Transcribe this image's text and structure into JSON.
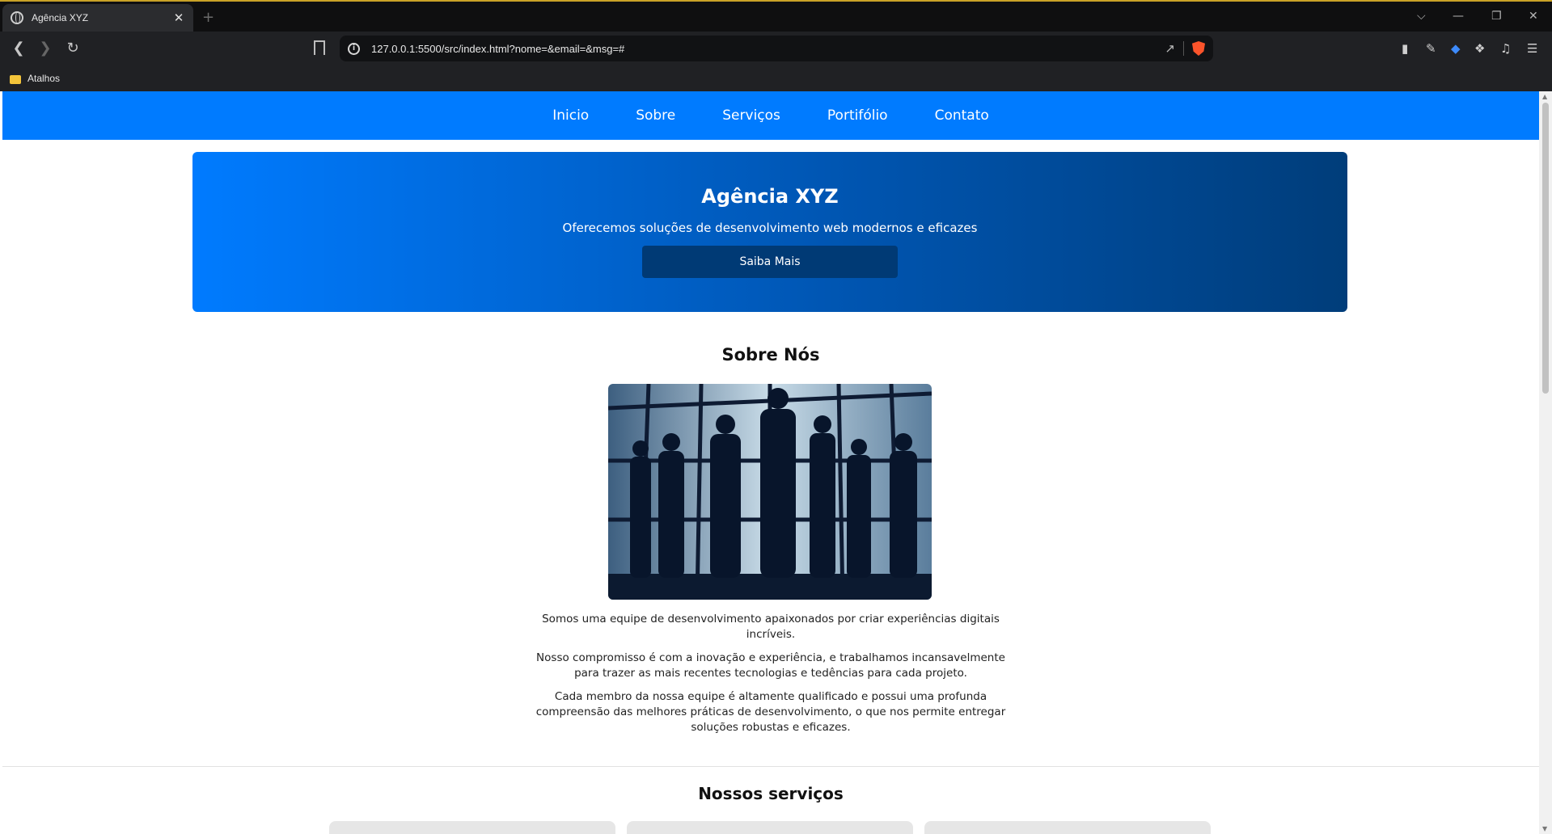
{
  "browser": {
    "tab_title": "Agência XYZ",
    "tab_close": "✕",
    "new_tab": "+",
    "url": "127.0.0.1:5500/src/index.html?nome=&email=&msg=#",
    "bookmark_folder": "Atalhos",
    "window_controls": [
      "⌵",
      "—",
      "❐",
      "✕"
    ]
  },
  "nav": {
    "items": [
      "Inicio",
      "Sobre",
      "Serviços",
      "Portifólio",
      "Contato"
    ]
  },
  "hero": {
    "title": "Agência XYZ",
    "subtitle": "Oferecemos soluções de desenvolvimento web modernos e eficazes",
    "button": "Saiba Mais"
  },
  "about": {
    "title": "Sobre Nós",
    "paragraphs": [
      "Somos uma equipe de desenvolvimento apaixonados por criar experiências digitais incríveis.",
      "Nosso compromisso é com a inovação e experiência, e trabalhamos incansavelmente para trazer as mais recentes tecnologias e tedências para cada projeto.",
      "Cada membro da nossa equipe é altamente qualificado e possui uma profunda compreensão das melhores práticas de desenvolvimento, o que nos permite entregar soluções robustas e eficazes."
    ]
  },
  "services": {
    "title": "Nossos serviços"
  },
  "colors": {
    "primary": "#007bff",
    "hero_dark": "#003d7a",
    "button_dark": "#003a75"
  }
}
